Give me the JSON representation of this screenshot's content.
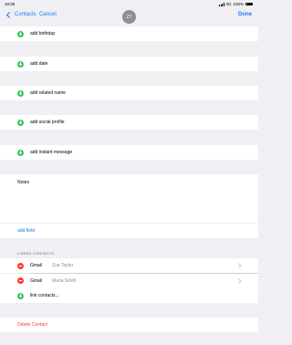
{
  "status_bar": {
    "time": "10:00",
    "network": "3G",
    "battery": "100%"
  },
  "nav": {
    "back_label": "Contacts",
    "cancel_label": "Cancel",
    "avatar_initials": "ZT",
    "done_label": "Done"
  },
  "add_rows": [
    {
      "label": "add birthday"
    },
    {
      "label": "add date"
    },
    {
      "label": "add related name"
    },
    {
      "label": "add social profile"
    },
    {
      "label": "add instant message"
    }
  ],
  "notes": {
    "label": "Notes"
  },
  "add_field": {
    "label": "add field"
  },
  "linked": {
    "header": "LINKED CONTACTS",
    "items": [
      {
        "source": "Gmail",
        "name": "Zoe Taylor"
      },
      {
        "source": "Gmail",
        "name": "Maria Smith"
      }
    ],
    "link_label": "link contacts..."
  },
  "delete": {
    "label": "Delete Contact"
  },
  "colors": {
    "accent": "#1a7cf5",
    "add": "#34c759",
    "remove": "#ff3b30",
    "background": "#efeff4"
  }
}
